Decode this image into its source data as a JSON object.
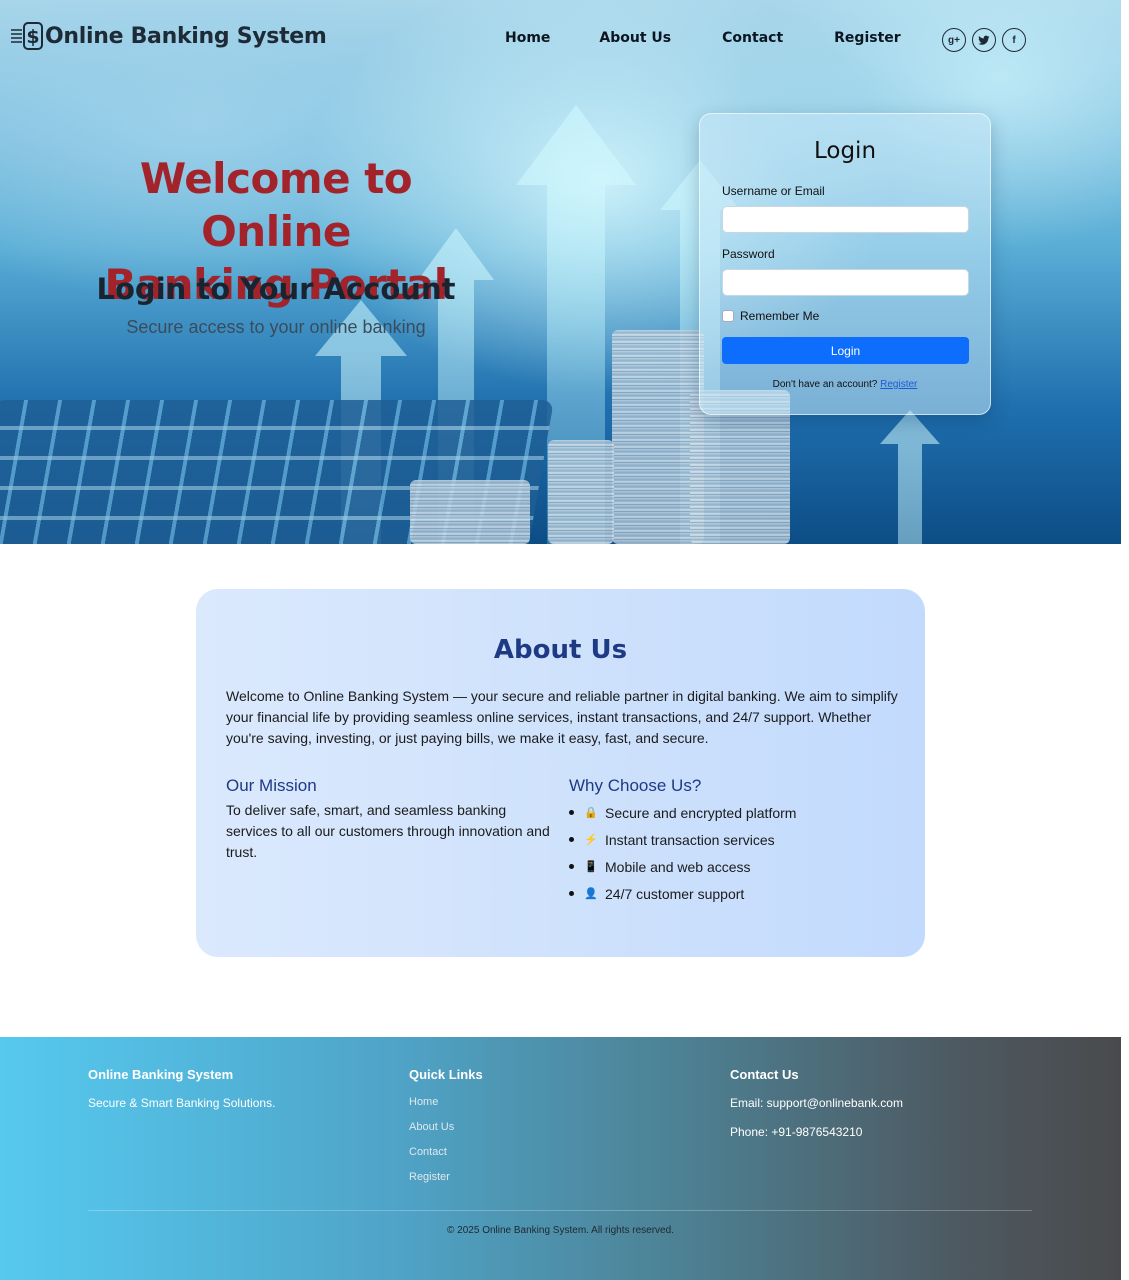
{
  "brand": {
    "title": "Online Banking System",
    "logo_icon": "dollar-coin-icon"
  },
  "nav": {
    "items": [
      "Home",
      "About Us",
      "Contact",
      "Register"
    ]
  },
  "social": [
    {
      "icon": "google-plus-icon",
      "glyph": "g+"
    },
    {
      "icon": "twitter-icon",
      "glyph": "t"
    },
    {
      "icon": "facebook-icon",
      "glyph": "f"
    }
  ],
  "hero": {
    "title_line1": "Welcome to Online",
    "title_line2": "Banking Portal",
    "subtitle": "Login to Your Account",
    "tagline": "Secure access to your online banking"
  },
  "login": {
    "title": "Login",
    "username_label": "Username or Email",
    "username_value": "",
    "password_label": "Password",
    "password_value": "",
    "remember_label": "Remember Me",
    "button_label": "Login",
    "no_account_text": "Don't have an account?",
    "register_link": "Register"
  },
  "about": {
    "title": "About Us",
    "intro": "Welcome to Online Banking System — your secure and reliable partner in digital banking. We aim to simplify your financial life by providing seamless online services, instant transactions, and 24/7 support. Whether you're saving, investing, or just paying bills, we make it easy, fast, and secure.",
    "mission_title": "Our Mission",
    "mission_text": "To deliver safe, smart, and seamless banking services to all our customers through innovation and trust.",
    "why_title": "Why Choose Us?",
    "why_items": [
      {
        "icon": "lock-icon",
        "glyph": "🔒",
        "text": "Secure and encrypted platform"
      },
      {
        "icon": "lightning-icon",
        "glyph": "⚡",
        "text": "Instant transaction services"
      },
      {
        "icon": "mobile-phone-icon",
        "glyph": "📱",
        "text": "Mobile and web access"
      },
      {
        "icon": "support-person-icon",
        "glyph": "👤",
        "text": "24/7 customer support"
      }
    ]
  },
  "footer": {
    "brand_title": "Online Banking System",
    "brand_tagline": "Secure & Smart Banking Solutions.",
    "quick_links_title": "Quick Links",
    "quick_links": [
      "Home",
      "About Us",
      "Contact",
      "Register"
    ],
    "contact_title": "Contact Us",
    "email": "Email: support@onlinebank.com",
    "phone": "Phone: +91-9876543210",
    "copyright": "© 2025 Online Banking System. All rights reserved."
  },
  "colors": {
    "hero_title": "#a3232b",
    "about_heading": "#1f3a85",
    "primary_button": "#0d6efd",
    "footer_gradient_start": "#56c9ef",
    "footer_gradient_end": "#4a4a4c"
  }
}
